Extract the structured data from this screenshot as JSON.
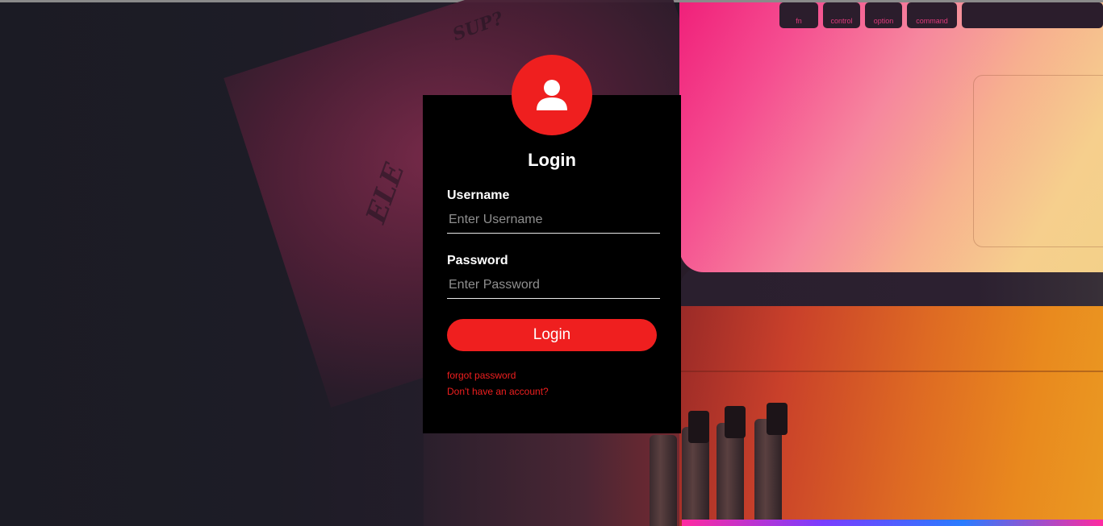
{
  "login": {
    "title": "Login",
    "username_label": "Username",
    "username_placeholder": "Enter Username",
    "username_value": "",
    "password_label": "Password",
    "password_placeholder": "Enter Password",
    "password_value": "",
    "submit_label": "Login",
    "forgot_link": "forgot password",
    "signup_link": "Don't have an account?"
  },
  "icons": {
    "avatar": "user-icon"
  },
  "colors": {
    "accent": "#ef1f1f",
    "card_background": "#000000",
    "text": "#ffffff",
    "placeholder": "#8f8f8f"
  },
  "background": {
    "keys": [
      "fn",
      "control",
      "option",
      "command"
    ]
  }
}
